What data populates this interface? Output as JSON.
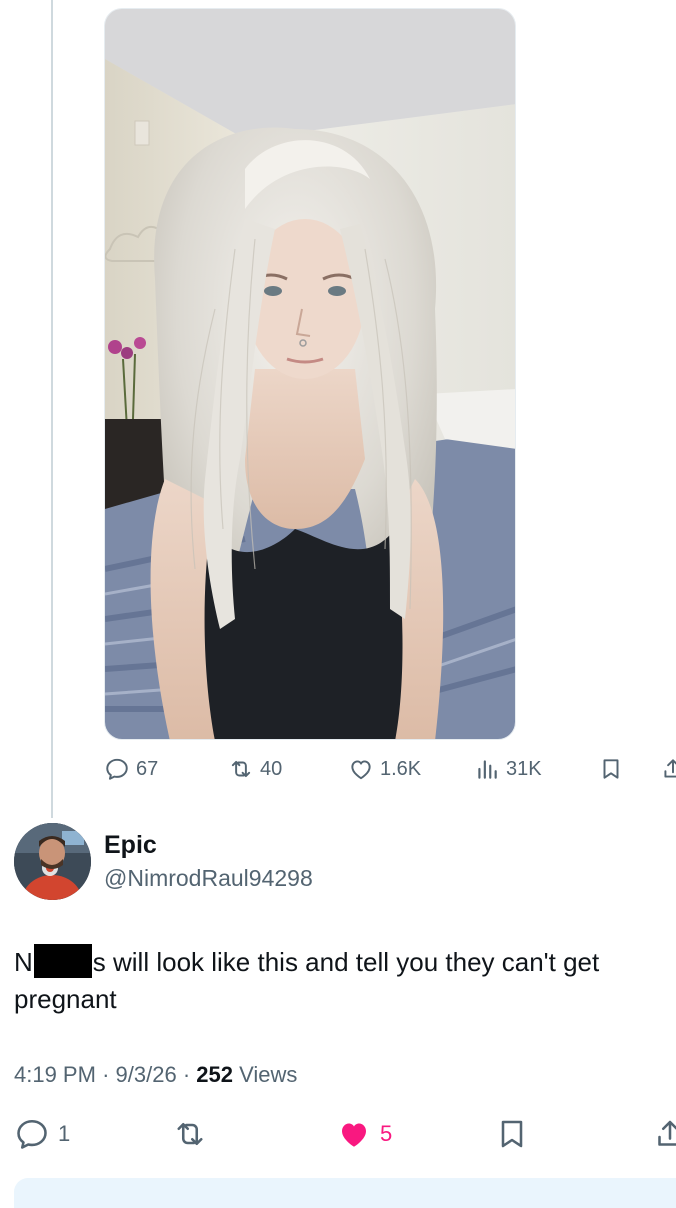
{
  "parent_tweet": {
    "image_alt": "Selfie of a person with long platinum blonde hair wearing a black tank top in a bedroom",
    "metrics": {
      "replies": "67",
      "reposts": "40",
      "likes": "1.6K",
      "views": "31K"
    },
    "icons": [
      "reply-icon",
      "repost-icon",
      "like-icon",
      "views-icon",
      "bookmark-icon",
      "share-icon"
    ]
  },
  "tweet": {
    "author": {
      "display_name": "Epic",
      "handle": "@NimrodRaul94298"
    },
    "text_prefix": "N",
    "text_suffix": "s will look like this and tell you they can't get pregnant",
    "time": "4:19 PM",
    "separator": "·",
    "date": "9/3/26",
    "views_count": "252",
    "views_label": "Views",
    "metrics": {
      "replies": "1",
      "reposts": "",
      "likes": "5"
    },
    "colors": {
      "like_active": "#f91880",
      "muted": "#536471",
      "text": "#0f1419",
      "reply_box": "#eaf5fd"
    }
  }
}
